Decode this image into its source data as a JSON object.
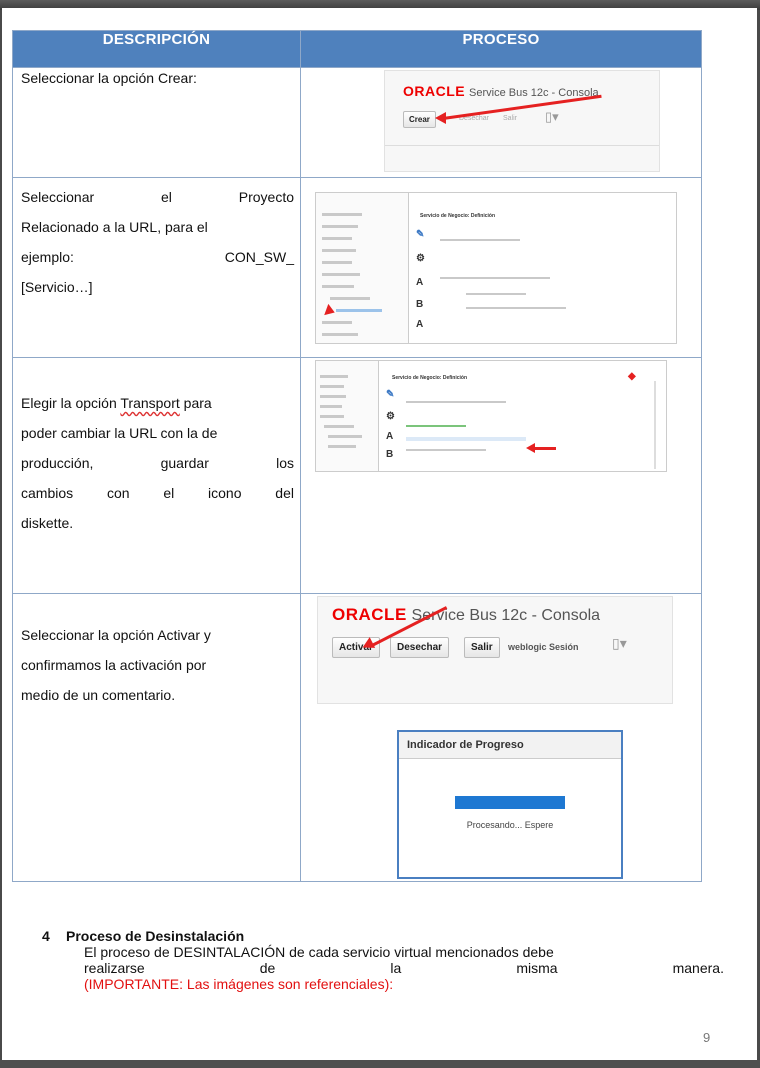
{
  "table": {
    "headers": {
      "description": "DESCRIPCIÓN",
      "process": "PROCESO"
    },
    "rows": [
      {
        "text": "Seleccionar la opción Crear:"
      },
      {
        "line1": [
          "Seleccionar",
          "el",
          "Proyecto"
        ],
        "line2": "Relacionado a la URL, para el",
        "line3": [
          "ejemplo:",
          "CON_SW_"
        ],
        "line4": "[Servicio…]"
      },
      {
        "pre": "Elegir la opción ",
        "word": "Transport",
        "post": " para",
        "line2": "poder cambiar la URL con la de",
        "line3": [
          "producción,",
          "guardar",
          "los"
        ],
        "line4": [
          "cambios",
          "con",
          "el",
          "icono",
          "del"
        ],
        "line5": "diskette."
      },
      {
        "line1": "Seleccionar la opción Activar y",
        "line2": "confirmamos la activación por",
        "line3": "medio de un comentario."
      }
    ]
  },
  "shot1": {
    "brand": "ORACLE",
    "product": "Service Bus 12c - Consola",
    "button_create": "Crear",
    "button_discard": "Desechar",
    "button_exit": "Salir"
  },
  "shot2": {
    "title": "Servicio de Negocio: Definición"
  },
  "shot3": {
    "title": "Servicio de Negocio: Definición"
  },
  "shot4": {
    "brand": "ORACLE",
    "product": "Service Bus 12c - Consola",
    "button_activate": "Activar",
    "button_discard": "Desechar",
    "button_exit": "Salir",
    "session": "weblogic Sesión"
  },
  "shot5": {
    "title": "Indicador de Progreso",
    "message": "Procesando... Espere"
  },
  "section": {
    "number": "4",
    "title": "Proceso de Desinstalación",
    "line1": "El proceso de DESINTALACIÓN de cada servicio virtual mencionados debe",
    "line2": [
      "realizarse",
      "de",
      "la",
      "misma",
      "manera."
    ],
    "note": "(IMPORTANTE: Las imágenes son referenciales):"
  },
  "page_number": "9",
  "colors": {
    "header_bg": "#4f81bd",
    "oracle_red": "#e00000",
    "note_red": "#e21010",
    "progress_blue": "#1e78d2"
  }
}
